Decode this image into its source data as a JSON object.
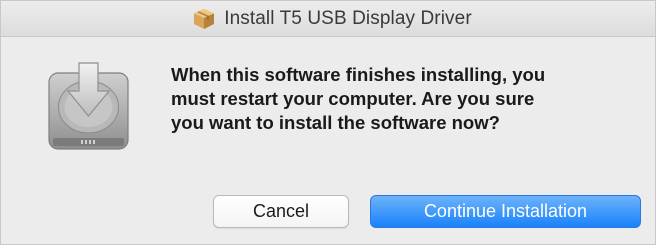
{
  "window": {
    "title": "Install T5 USB Display Driver",
    "title_icon": "package-icon"
  },
  "dialog": {
    "icon": "drive-install-icon",
    "message": "When this software finishes installing, you\nmust restart your computer. Are you sure\nyou want to install the software now?"
  },
  "buttons": {
    "cancel_label": "Cancel",
    "continue_label": "Continue Installation"
  },
  "colors": {
    "accent": "#1a82fb",
    "background": "#ececec"
  }
}
